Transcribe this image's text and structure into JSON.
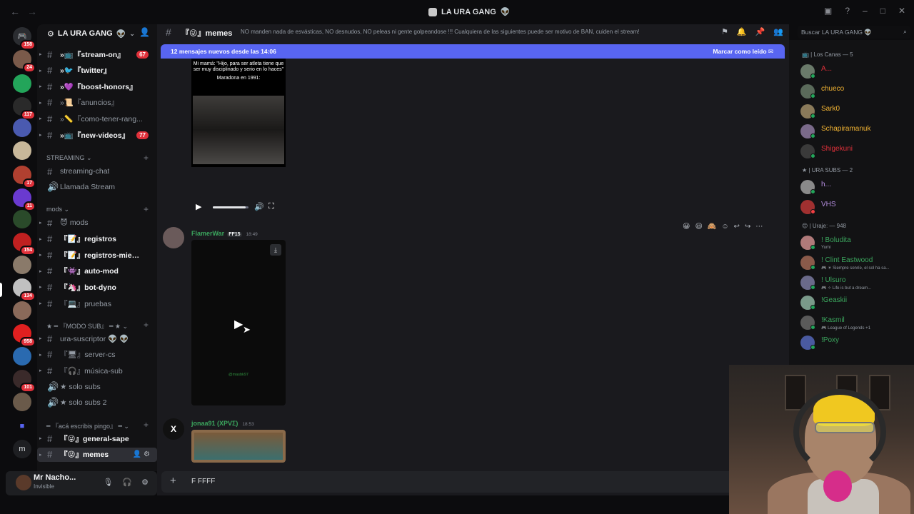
{
  "window": {
    "title": "LA URA GANG",
    "title_icon": "server-icon"
  },
  "server": {
    "name": "LA URA GANG",
    "name_emoji": "👽"
  },
  "channels": [
    {
      "label": "»📺『stream-on』",
      "unread": true,
      "badge": "67",
      "hash": true
    },
    {
      "label": "»🐦『twitter』",
      "unread": true,
      "hash": true
    },
    {
      "label": "»💜『boost-honors』",
      "unread": true,
      "hash": true
    },
    {
      "label": "»📜『anuncios』",
      "unread": false,
      "hash": true
    },
    {
      "label": "»📏『como-tener-rang...",
      "unread": false,
      "hash": true
    },
    {
      "label": "»📺『new-videos』",
      "unread": true,
      "badge": "77",
      "hash": true
    }
  ],
  "categories": {
    "streaming": "STREAMING",
    "mods": "mods",
    "modo_sub": "★ ━ 『MODO SUB』 ━ ★",
    "aca_escribis": "━ 『acá escribis pingo』 ━"
  },
  "streaming_channels": [
    {
      "label": "streaming-chat",
      "type": "text"
    },
    {
      "label": "Llamada Stream",
      "type": "voice"
    }
  ],
  "mods_channels": [
    {
      "label": "😈 mods",
      "unread": false
    },
    {
      "label": "『📝』registros",
      "unread": true
    },
    {
      "label": "『📝』registros-miem...",
      "unread": true
    },
    {
      "label": "『👾』auto-mod",
      "unread": true
    },
    {
      "label": "『🦄』bot-dyno",
      "unread": true
    },
    {
      "label": "『💻』pruebas",
      "unread": false
    }
  ],
  "sub_channels": [
    {
      "label": "ura-suscriptor 👽 👽",
      "type": "text"
    },
    {
      "label": "『🖥』server-cs",
      "type": "text"
    },
    {
      "label": "『🎧』música-sub",
      "type": "text"
    },
    {
      "label": "★ solo subs",
      "type": "voice"
    },
    {
      "label": "★ solo subs 2",
      "type": "voice"
    }
  ],
  "general_channels": [
    {
      "label": "『😜』general-sape",
      "unread": true,
      "active": false
    },
    {
      "label": "『😜』memes",
      "unread": true,
      "active": true
    }
  ],
  "user": {
    "name": "Mr Nacho...",
    "status": "Invisible"
  },
  "guild_badges": [
    "158",
    "24",
    "117",
    "17",
    "11",
    "154",
    "134",
    "958",
    "101"
  ],
  "header": {
    "channel_name": "『😜』memes",
    "topic": "NO manden nada de esvásticas, NO desnudos, NO peleas ni gente golpeandose !!! Cualquiera de las siguientes puede ser motivo de BAN, cuiden el stream!",
    "search_placeholder": "Buscar LA URA GANG 👽"
  },
  "new_messages_bar": {
    "text": "12 mensajes nuevos desde las 14:06",
    "action": "Marcar como leído"
  },
  "meme": {
    "caption": "Mi mamá: \"Hijo, para ser atleta tiene que ser muy disciplinado y serio en lo haces\"",
    "caption2": "Maradona en 1991:"
  },
  "messages": [
    {
      "author": "FlamerWar",
      "tag": "FF15",
      "time": "18:49",
      "author_color": "#3ba55d"
    },
    {
      "author": "jonaa91 (XPVΣ)",
      "time": "18:53",
      "author_color": "#3ba55d"
    }
  ],
  "video_watermark": "@masbk97",
  "composer": {
    "text": "F FFFF"
  },
  "members": {
    "groups": [
      {
        "title": "📺 | Los Canas — 5",
        "members": [
          {
            "name": "A...",
            "color": "#e0303a",
            "avatar": "#6a7a6a",
            "status": "#23a55a"
          },
          {
            "name": "chueco",
            "color": "#f0b232",
            "avatar": "#5a6a5a",
            "status": "#23a55a"
          },
          {
            "name": "Sark0",
            "color": "#f0b232",
            "avatar": "#8a7a5a",
            "status": "#23a55a"
          },
          {
            "name": "Schapiramanuk",
            "color": "#f0b232",
            "avatar": "#7a6a8a",
            "status": "#23a55a"
          },
          {
            "name": "Shigekuni",
            "color": "#e0303a",
            "avatar": "#3a3a3a",
            "status": "#23a55a"
          }
        ]
      },
      {
        "title": "★ | URA SUBS — 2",
        "members": [
          {
            "name": "h...",
            "color": "#b58ee0",
            "avatar": "#8a8a8a",
            "status": "#23a55a"
          },
          {
            "name": "VHS",
            "color": "#b58ee0",
            "avatar": "#a03030",
            "status": "#f23f43"
          }
        ]
      },
      {
        "title": "😊 | Urajeː — 948",
        "members": [
          {
            "name": "! Boludita",
            "sub": "Yumi",
            "color": "#3ba55d",
            "avatar": "#b07a7a",
            "status": "#23a55a"
          },
          {
            "name": "! Clint Eastwood",
            "sub": "🎮 ☀ Siempre sonríe, el sol ha sa...",
            "color": "#3ba55d",
            "avatar": "#8a5a4a",
            "status": "#23a55a"
          },
          {
            "name": "! Ulsuro",
            "sub": "🎮 ✧ Life is but a dream...",
            "color": "#3ba55d",
            "avatar": "#6a6a8a",
            "status": "#23a55a"
          },
          {
            "name": "!Geaskii",
            "color": "#3ba55d",
            "avatar": "#7a9a8a",
            "status": "#23a55a"
          },
          {
            "name": "!Kasmil",
            "sub": "🎮 League of Legends +1",
            "color": "#3ba55d",
            "avatar": "#5a5a5a",
            "status": "#23a55a"
          },
          {
            "name": "!Poxy",
            "color": "#3ba55d",
            "avatar": "#4a5aa0",
            "status": "#23a55a"
          }
        ]
      }
    ]
  },
  "colors": {
    "accent": "#5865f2",
    "badge": "#e0303a",
    "online": "#23a55a"
  }
}
